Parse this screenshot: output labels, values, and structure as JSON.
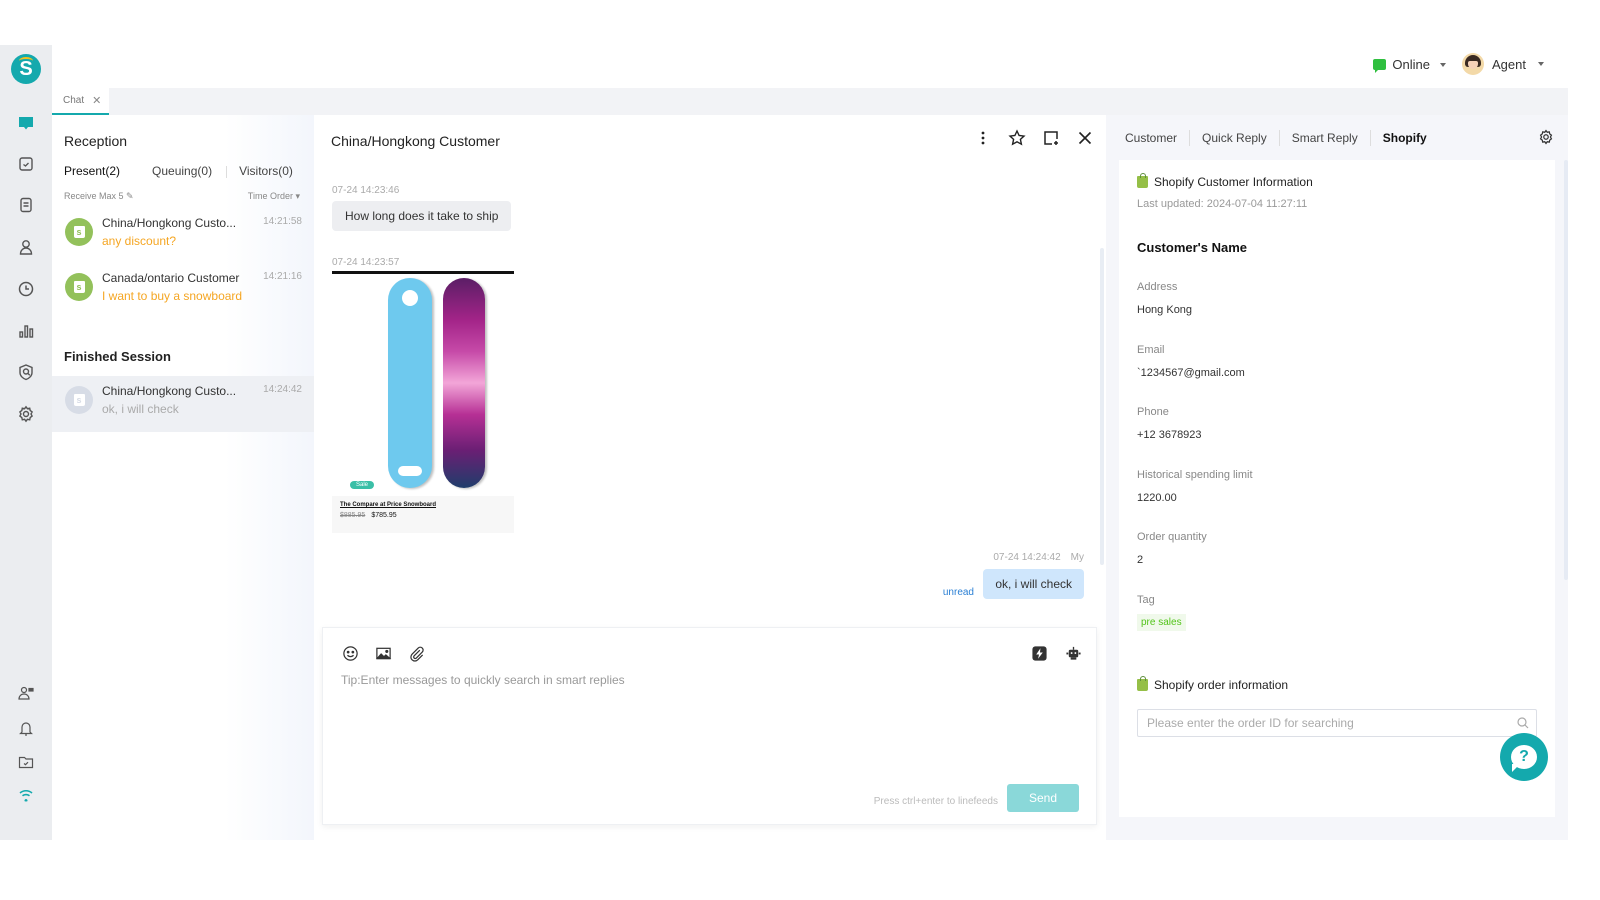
{
  "app": {
    "logo_letter": "S",
    "brand_color": "#14a9ad"
  },
  "rail": {
    "top_items": [
      {
        "name": "chat",
        "icon": "chat-bubble-icon",
        "active": true
      },
      {
        "name": "tasks",
        "icon": "checkbox-icon"
      },
      {
        "name": "documents",
        "icon": "document-icon"
      },
      {
        "name": "contacts",
        "icon": "user-icon"
      },
      {
        "name": "history",
        "icon": "clock-icon"
      },
      {
        "name": "statistics",
        "icon": "bar-chart-icon"
      },
      {
        "name": "monitor",
        "icon": "shield-search-icon"
      },
      {
        "name": "settings",
        "icon": "gear-icon"
      }
    ],
    "bottom_items": [
      {
        "name": "agent-card",
        "icon": "user-card-icon"
      },
      {
        "name": "notifications",
        "icon": "bell-icon"
      },
      {
        "name": "files",
        "icon": "folder-check-icon"
      },
      {
        "name": "connection",
        "icon": "wifi-icon"
      }
    ]
  },
  "header": {
    "status_label": "Online",
    "status_color": "#2fbf3f",
    "agent_label": "Agent"
  },
  "tabs": [
    {
      "label": "Chat",
      "active": true
    }
  ],
  "reception": {
    "title": "Reception",
    "tabs": [
      {
        "label": "Present(2)",
        "active": true
      },
      {
        "label": "Queuing(0)"
      },
      {
        "label": "Visitors(0)"
      }
    ],
    "receive_max": "Receive Max 5",
    "sort_label": "Time Order",
    "sessions": [
      {
        "name": "China/Hongkong Custo...",
        "time": "14:21:58",
        "message": "any discount?"
      },
      {
        "name": "Canada/ontario Customer",
        "time": "14:21:16",
        "message": "I want to buy a snowboard"
      }
    ],
    "finished_title": "Finished Session",
    "finished": [
      {
        "name": "China/Hongkong Custo...",
        "time": "14:24:42",
        "message": "ok, i will check"
      }
    ]
  },
  "chat": {
    "title": "China/Hongkong Customer",
    "messages": [
      {
        "direction": "in",
        "timestamp": "07-24 14:23:46",
        "text": "How long does it take to ship"
      },
      {
        "direction": "in",
        "timestamp": "07-24 14:23:57",
        "type": "product",
        "product": {
          "badge": "Sale",
          "name": "The Compare at Price Snowboard",
          "old_price": "$885.95",
          "price": "$785.95"
        }
      },
      {
        "direction": "out",
        "timestamp": "07-24 14:24:42",
        "sender": "My",
        "text": "ok, i will check",
        "status": "unread"
      }
    ],
    "composer": {
      "placeholder": "Tip:Enter messages to quickly search in smart replies",
      "hint": "Press ctrl+enter to linefeeds",
      "send_label": "Send"
    }
  },
  "right_panel": {
    "tabs": [
      {
        "label": "Customer"
      },
      {
        "label": "Quick Reply"
      },
      {
        "label": "Smart Reply"
      },
      {
        "label": "Shopify",
        "active": true
      }
    ],
    "customer_info": {
      "title": "Shopify Customer Information",
      "last_updated": "Last updated: 2024-07-04 11:27:11",
      "name": "Customer's Name",
      "fields": [
        {
          "label": "Address",
          "value": "Hong Kong"
        },
        {
          "label": "Email",
          "value": "`1234567@gmail.com"
        },
        {
          "label": "Phone",
          "value": "+12 3678923"
        },
        {
          "label": "Historical spending limit",
          "value": "1220.00"
        },
        {
          "label": "Order quantity",
          "value": "2"
        }
      ],
      "tag_label": "Tag",
      "tags": [
        "pre sales"
      ]
    },
    "order_info": {
      "title": "Shopify order information",
      "search_placeholder": "Please enter the order ID for searching",
      "search_value": ""
    }
  }
}
